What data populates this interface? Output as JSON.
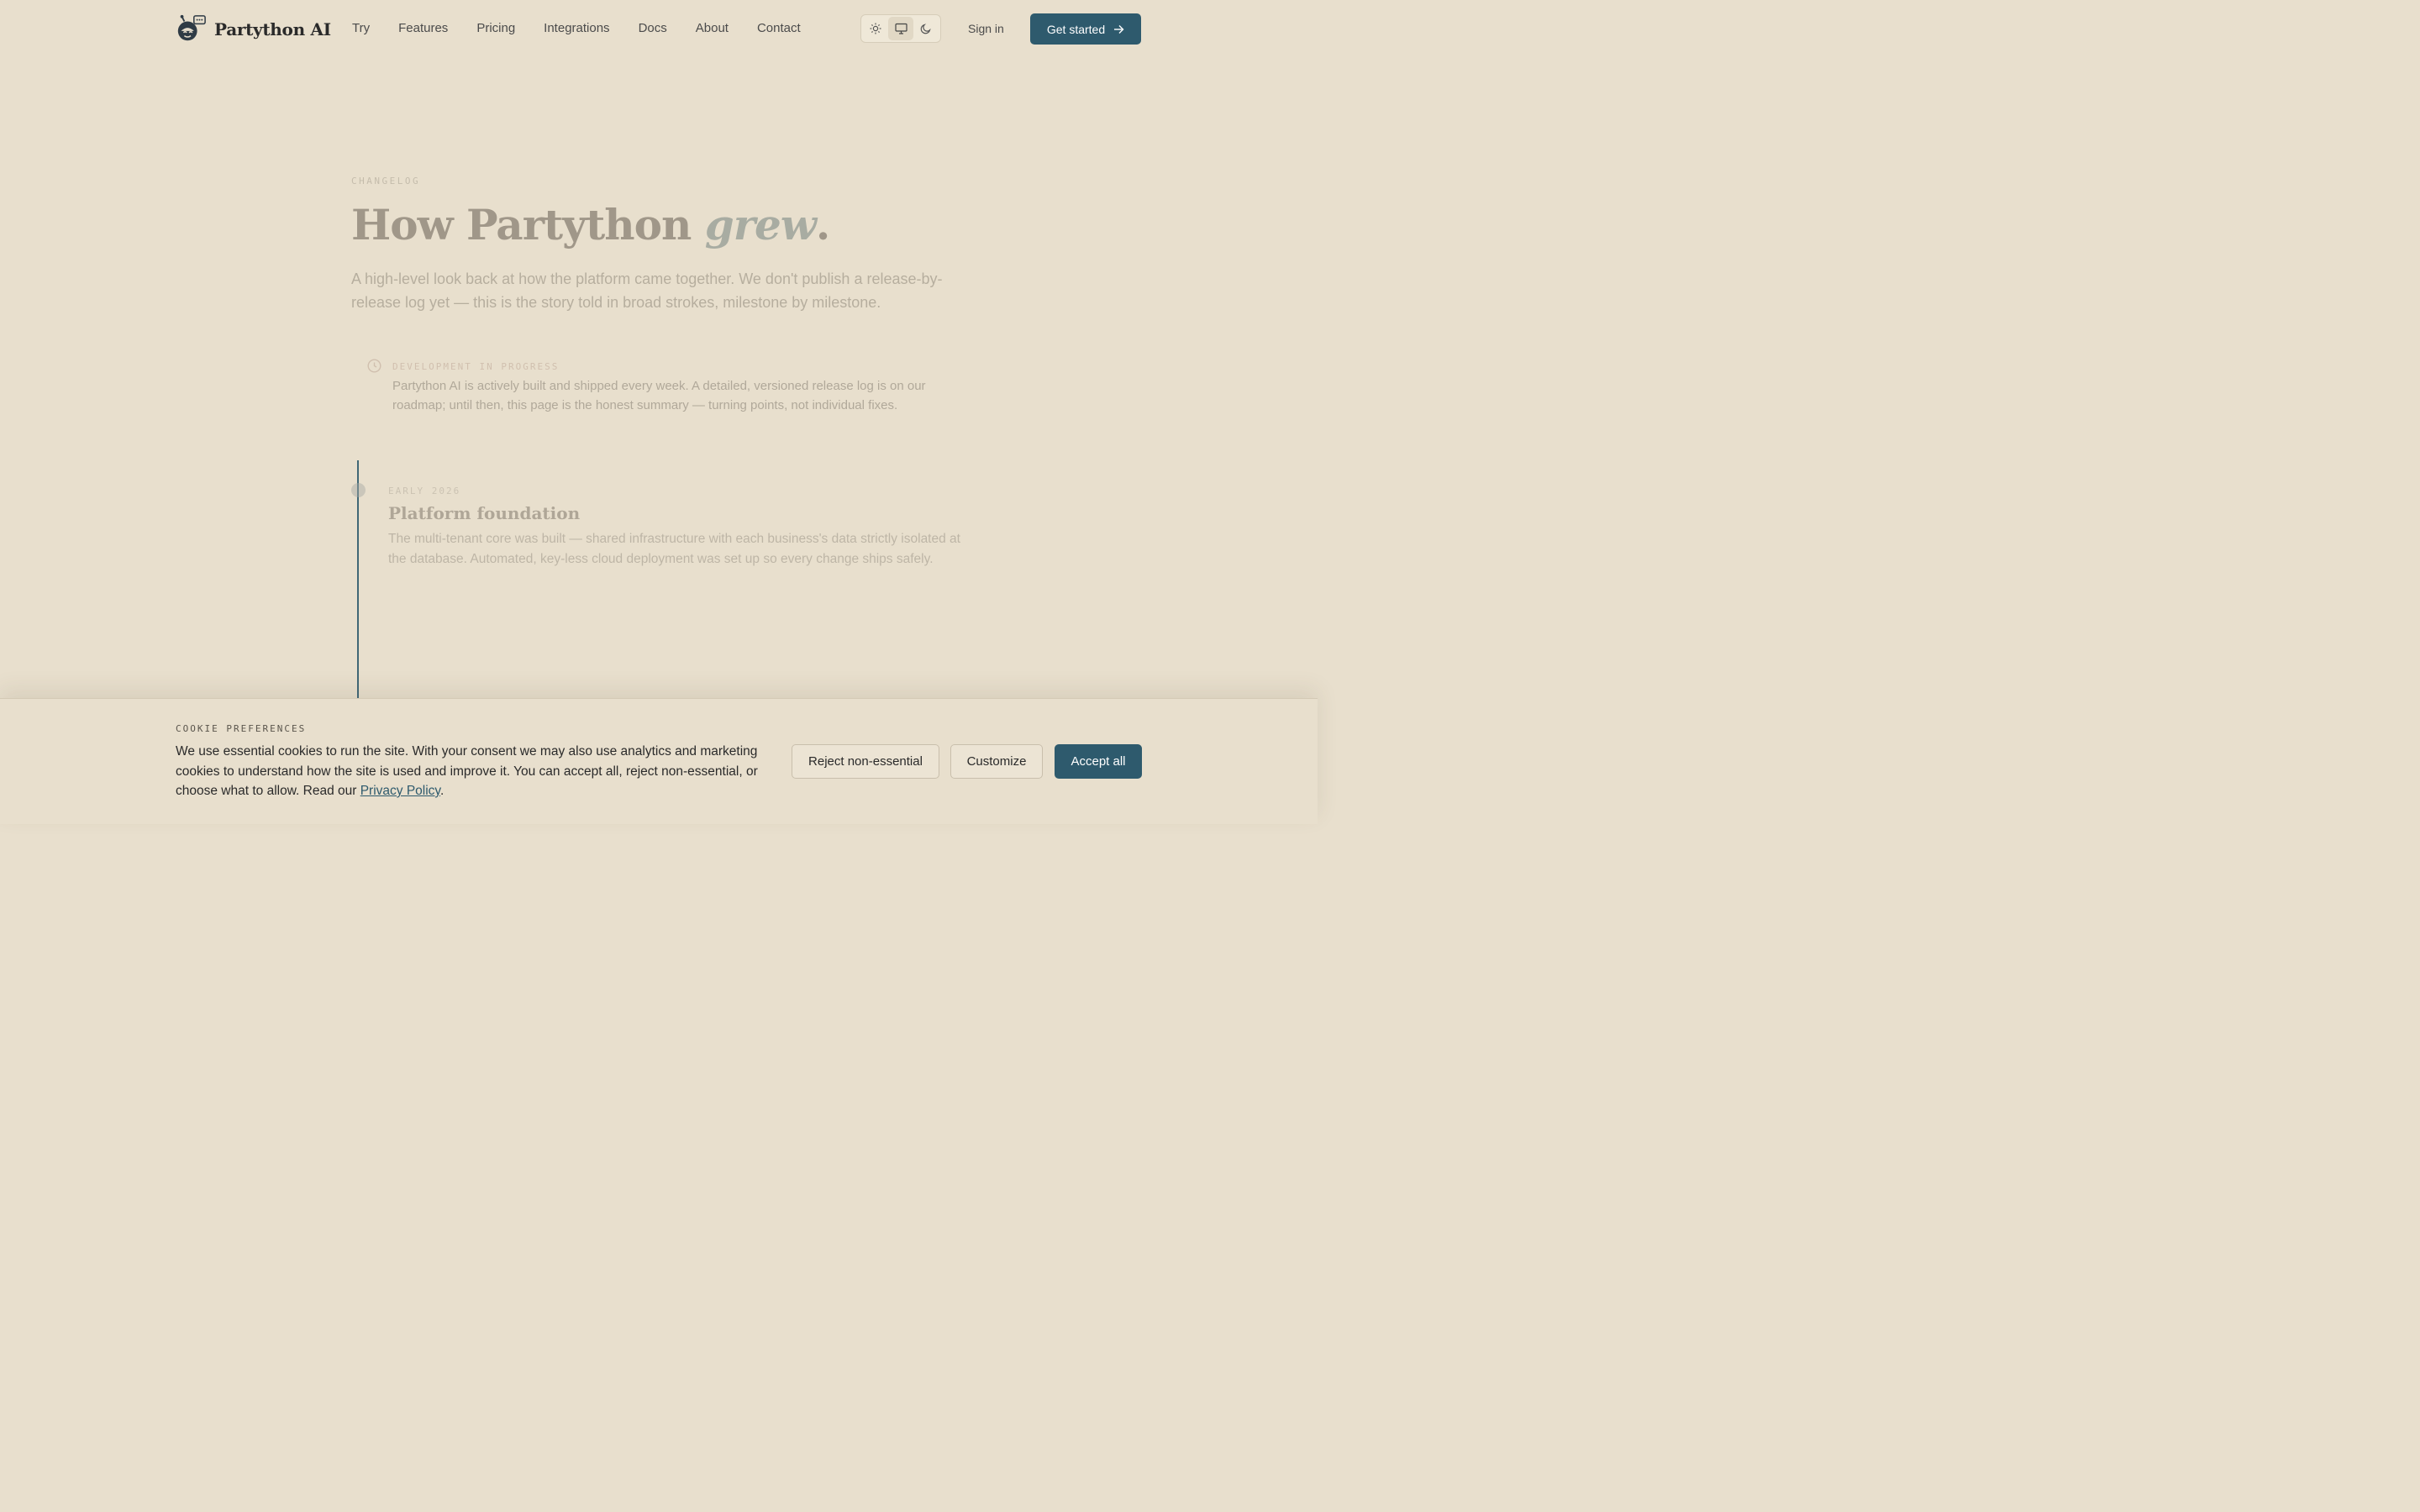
{
  "header": {
    "brand": "Partython AI",
    "nav": [
      "Try",
      "Features",
      "Pricing",
      "Integrations",
      "Docs",
      "About",
      "Contact"
    ],
    "theme_options": [
      "sun-icon",
      "monitor-icon",
      "moon-icon"
    ],
    "theme_selected": "monitor-icon",
    "signin_label": "Sign in",
    "cta_label": "Get started"
  },
  "hero": {
    "eyebrow": "CHANGELOG",
    "title_main": "How Partython ",
    "title_em": "grew",
    "title_end": ".",
    "subtitle": "A high-level look back at how the platform came together. We don't publish a release-by-release log yet — this is the story told in broad strokes, milestone by milestone."
  },
  "notice": {
    "label": "DEVELOPMENT IN PROGRESS",
    "text": "Partython AI is actively built and shipped every week. A detailed, versioned release log is on our roadmap; until then, this page is the honest summary — turning points, not individual fixes."
  },
  "timeline": [
    {
      "date": "EARLY 2026",
      "title": "Platform foundation",
      "text": "The multi-tenant core was built — shared infrastructure with each business's data strictly isolated at the database. Automated, key-less cloud deployment was set up so every change ships safely."
    }
  ],
  "cookie": {
    "label": "COOKIE PREFERENCES",
    "text_before": "We use essential cookies to run the site. With your consent we may also use analytics and marketing cookies to understand how the site is used and improve it. You can accept all, reject non-essential, or choose what to allow. Read our ",
    "link": "Privacy Policy",
    "text_after": ".",
    "reject_label": "Reject non-essential",
    "customize_label": "Customize",
    "accept_label": "Accept all"
  },
  "colors": {
    "background": "#e8dfcd",
    "accent": "#2e5a6d"
  }
}
